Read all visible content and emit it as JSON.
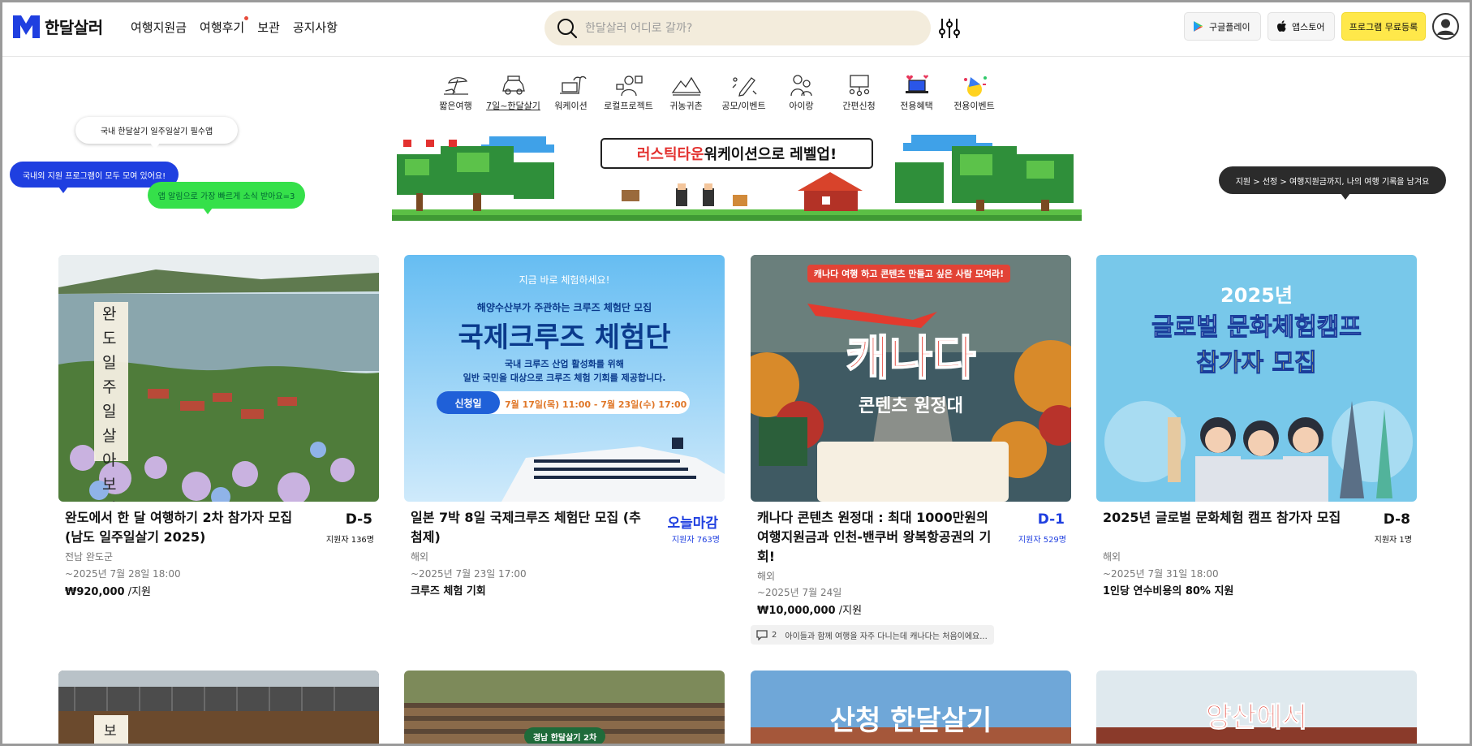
{
  "header": {
    "logo_text": "한달살러",
    "nav": [
      "여행지원금",
      "여행후기",
      "보관",
      "공지사항"
    ],
    "search_placeholder": "한달살러 어디로 갈까?",
    "google_play": "구글플레이",
    "app_store": "앱스토어",
    "register": "프로그램 무료등록"
  },
  "categories": [
    {
      "label": "짧은여행",
      "icon": "beach-umbrella-icon"
    },
    {
      "label": "7일~한달살기",
      "icon": "car-icon"
    },
    {
      "label": "워케이션",
      "icon": "laptop-palm-icon"
    },
    {
      "label": "로컬프로젝트",
      "icon": "local-project-icon"
    },
    {
      "label": "귀농귀촌",
      "icon": "mountain-icon"
    },
    {
      "label": "공모/이벤트",
      "icon": "pencil-event-icon"
    },
    {
      "label": "아이랑",
      "icon": "parent-child-icon"
    },
    {
      "label": "간편신청",
      "icon": "presentation-icon"
    },
    {
      "label": "전용혜택",
      "icon": "laptop-heart-icon"
    },
    {
      "label": "전용이벤트",
      "icon": "party-icon"
    }
  ],
  "bubbles": {
    "b1": "국내 한달살기 일주일살기 필수앱",
    "b2": "국내외 지원 프로그램이 모두 모여 있어요!",
    "b3": "앱 알림으로 가장 빠르게 소식 받아요=3",
    "b4": "지원 > 선정 > 여행지원금까지, 나의 여행 기록을 남겨요"
  },
  "banner": {
    "title_red": "러스틱타운",
    "title_rest": " 워케이션으로 레벨업!"
  },
  "cards": [
    {
      "title": "완도에서 한 달 여행하기 2차 참가자 모집 (남도 일주일살기 2025)",
      "dday": "D-5",
      "applicants": "지원자 136명",
      "region": "전남 완도군",
      "deadline": "~2025년 7월 28일 18:00",
      "price": "₩920,000",
      "price_unit": " /지원",
      "img_text": "완도 일주일 살아보기"
    },
    {
      "title": "일본 7박 8일 국제크루즈 체험단 모집 (추첨제)",
      "dday": "오늘마감",
      "applicants": "지원자 763명",
      "region": "해외",
      "deadline": "~2025년 7월 23일 17:00",
      "benefit": "크루즈 체험 기회",
      "img_tagline": "지금 바로 체험하세요!",
      "img_sub": "해양수산부가 주관하는 크루즈 체험단 모집",
      "img_title": "국제크루즈 체험단",
      "img_desc1": "국내 크루즈 산업 활성화를 위해",
      "img_desc2": "일반 국민을 대상으로 크루즈 체험 기회를 제공합니다.",
      "img_date_label": "신청일",
      "img_date": "7월 17일(목) 11:00 - 7월 23일(수) 17:00"
    },
    {
      "title": "캐나다 콘텐츠 원정대 : 최대 1000만원의 여행지원금과 인천-밴쿠버 왕복항공권의 기회!",
      "dday": "D-1",
      "applicants": "지원자 529명",
      "region": "해외",
      "deadline": "~2025년 7월 24일",
      "price": "₩10,000,000",
      "price_unit": " /지원",
      "comment_count": "2",
      "comment": "아이들과 함께 여행을 자주 다니는데 캐나다는 처음이에요...",
      "img_top": "캐나다 여행 하고 콘텐츠 만들고 싶은 사람 모여라!",
      "img_title": "캐나다",
      "img_sub": "콘텐츠 원정대"
    },
    {
      "title": "2025년 글로벌 문화체험 캠프 참가자 모집",
      "dday": "D-8",
      "applicants": "지원자 1명",
      "region": "해외",
      "deadline": "~2025년 7월 31일 18:00",
      "benefit": "1인당 연수비용의 80% 지원",
      "img_year": "2025년",
      "img_title1": "글로벌 문화체험캠프",
      "img_title2": "참가자 모집"
    }
  ],
  "row2": [
    {
      "img_text": "보성"
    },
    {
      "img_text": "경남 한달살기 2차"
    },
    {
      "img_text": "산청 한달살기"
    },
    {
      "img_text": "양산에서"
    }
  ],
  "colors": {
    "brand_blue": "#1f3fe0",
    "register_yellow": "#ffe84a",
    "search_bg": "#f3ecdc"
  }
}
